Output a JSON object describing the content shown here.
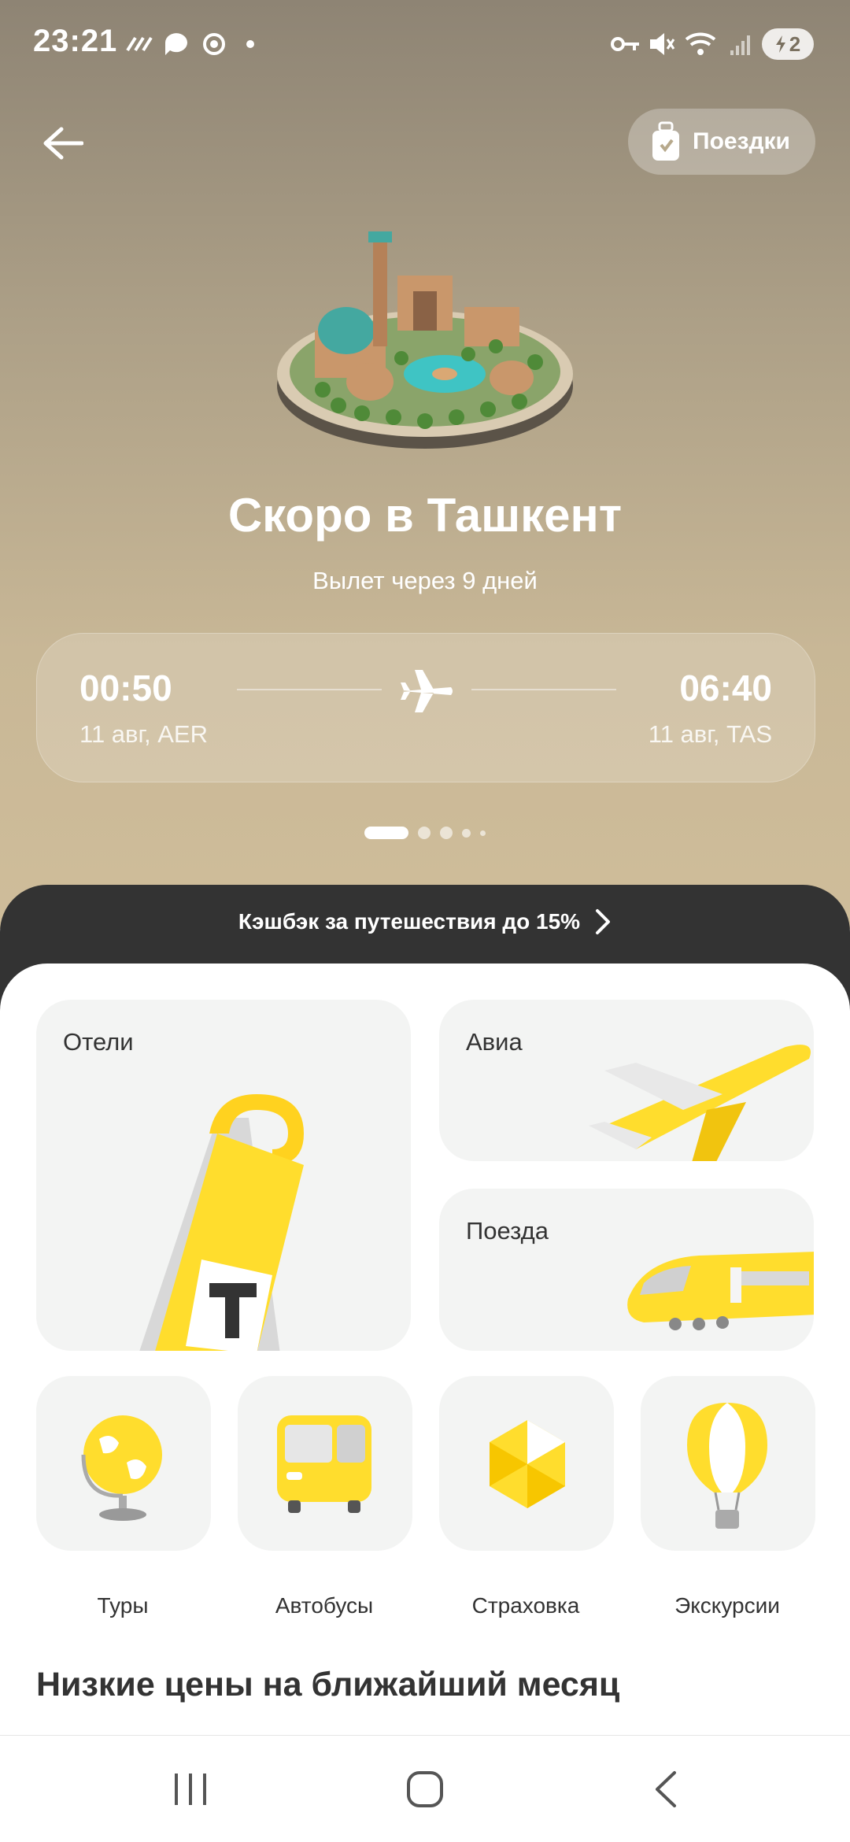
{
  "status": {
    "time": "23:21",
    "battery_level": "2"
  },
  "header": {
    "trips_label": "Поездки"
  },
  "hero": {
    "title": "Скоро в Ташкент",
    "subtitle": "Вылет через 9 дней"
  },
  "flight": {
    "departure_time": "00:50",
    "departure_info": "11 авг, AER",
    "arrival_time": "06:40",
    "arrival_info": "11 авг, TAS"
  },
  "cashback": {
    "label": "Кэшбэк за путешествия до 15%"
  },
  "services": {
    "hotels": "Отели",
    "avia": "Авиа",
    "trains": "Поезда",
    "tours": "Туры",
    "buses": "Автобусы",
    "insurance": "Страховка",
    "excursions": "Экскурсии"
  },
  "section": {
    "low_prices_title": "Низкие цены на ближайший месяц"
  },
  "colors": {
    "accent": "#ffdd2d",
    "dark_band": "#333333",
    "hero_bg": "#b7a98c"
  }
}
